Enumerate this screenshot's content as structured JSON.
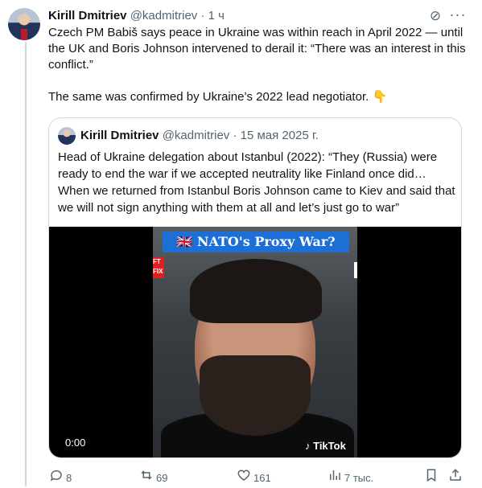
{
  "author": {
    "name": "Kirill Dmitriev",
    "handle": "@kadmitriev",
    "sep": "·",
    "time": "1 ч"
  },
  "tweet": {
    "paragraph1": "Czech PM Babiš says peace in Ukraine was within reach in April 2022 — until the UK and Boris Johnson intervened to derail it: “There was an interest in this conflict.”",
    "paragraph2": "The same was confirmed by Ukraine’s 2022 lead negotiator. 👇"
  },
  "quote": {
    "name": "Kirill Dmitriev",
    "handle": "@kadmitriev",
    "sep": "·",
    "date": "15 мая 2025 г.",
    "text": "Head of Ukraine delegation about Istanbul (2022): “They (Russia) were ready to end the war if we accepted neutrality like Finland once did… When we returned from Istanbul Boris Johnson came to Kiev and said that we will not sign anything with them at all and let’s just go to war”",
    "video": {
      "banner": "🇬🇧 NATO's Proxy War?",
      "timecode": "0:00",
      "watermark": "♪ TikTok",
      "tag": "FT FIX"
    }
  },
  "actions": {
    "replies": "8",
    "reposts": "69",
    "likes": "161",
    "views": "7 тыс."
  },
  "icons": {
    "grok": "grok-icon",
    "more": "more-icon",
    "reply": "reply-icon",
    "repost": "repost-icon",
    "like": "like-icon",
    "views": "views-icon",
    "bookmark": "bookmark-icon",
    "share": "share-icon"
  }
}
